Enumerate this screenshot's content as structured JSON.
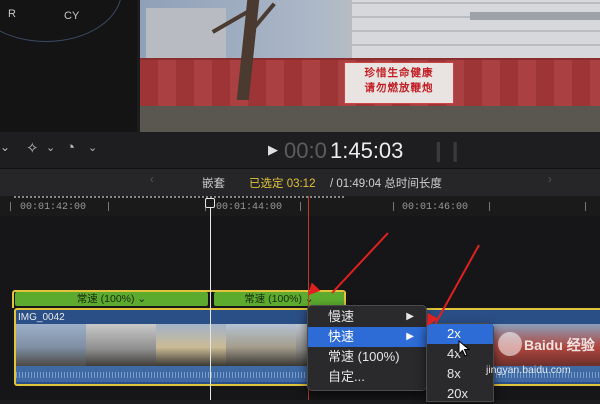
{
  "scope": {
    "label_r": "R",
    "label_cy": "CY"
  },
  "viewer": {
    "sign_line1": "珍惜生命健康",
    "sign_line2": "请勿燃放鞭炮"
  },
  "toolbar": {
    "play": "▶",
    "timecode_dim": "00:0",
    "timecode_bright": "1:45:03",
    "pause_glyph": "❙❙"
  },
  "infobar": {
    "nav_left": "‹",
    "nested": "嵌套",
    "selected": "已选定 03:12",
    "total": "/ 01:49:04 总时间长度",
    "nav_right": "›"
  },
  "ruler": {
    "ticks": [
      "00:01:42:00",
      "00:01:44:00",
      "00:01:46:00"
    ]
  },
  "timeline": {
    "speed_bars": [
      "常速 (100%) ⌄",
      "常速 (100%) ⌄"
    ],
    "clip_name": "IMG_0042"
  },
  "menu": {
    "items": [
      {
        "label": "慢速",
        "arrow": "▶"
      },
      {
        "label": "快速",
        "arrow": "▶"
      },
      {
        "label": "常速 (100%)"
      },
      {
        "label": "自定..."
      }
    ]
  },
  "submenu": {
    "items": [
      "2x",
      "4x",
      "8x",
      "20x"
    ]
  },
  "watermark": {
    "brand": "Baidu 经验",
    "url": "jingyan.baidu.com"
  }
}
